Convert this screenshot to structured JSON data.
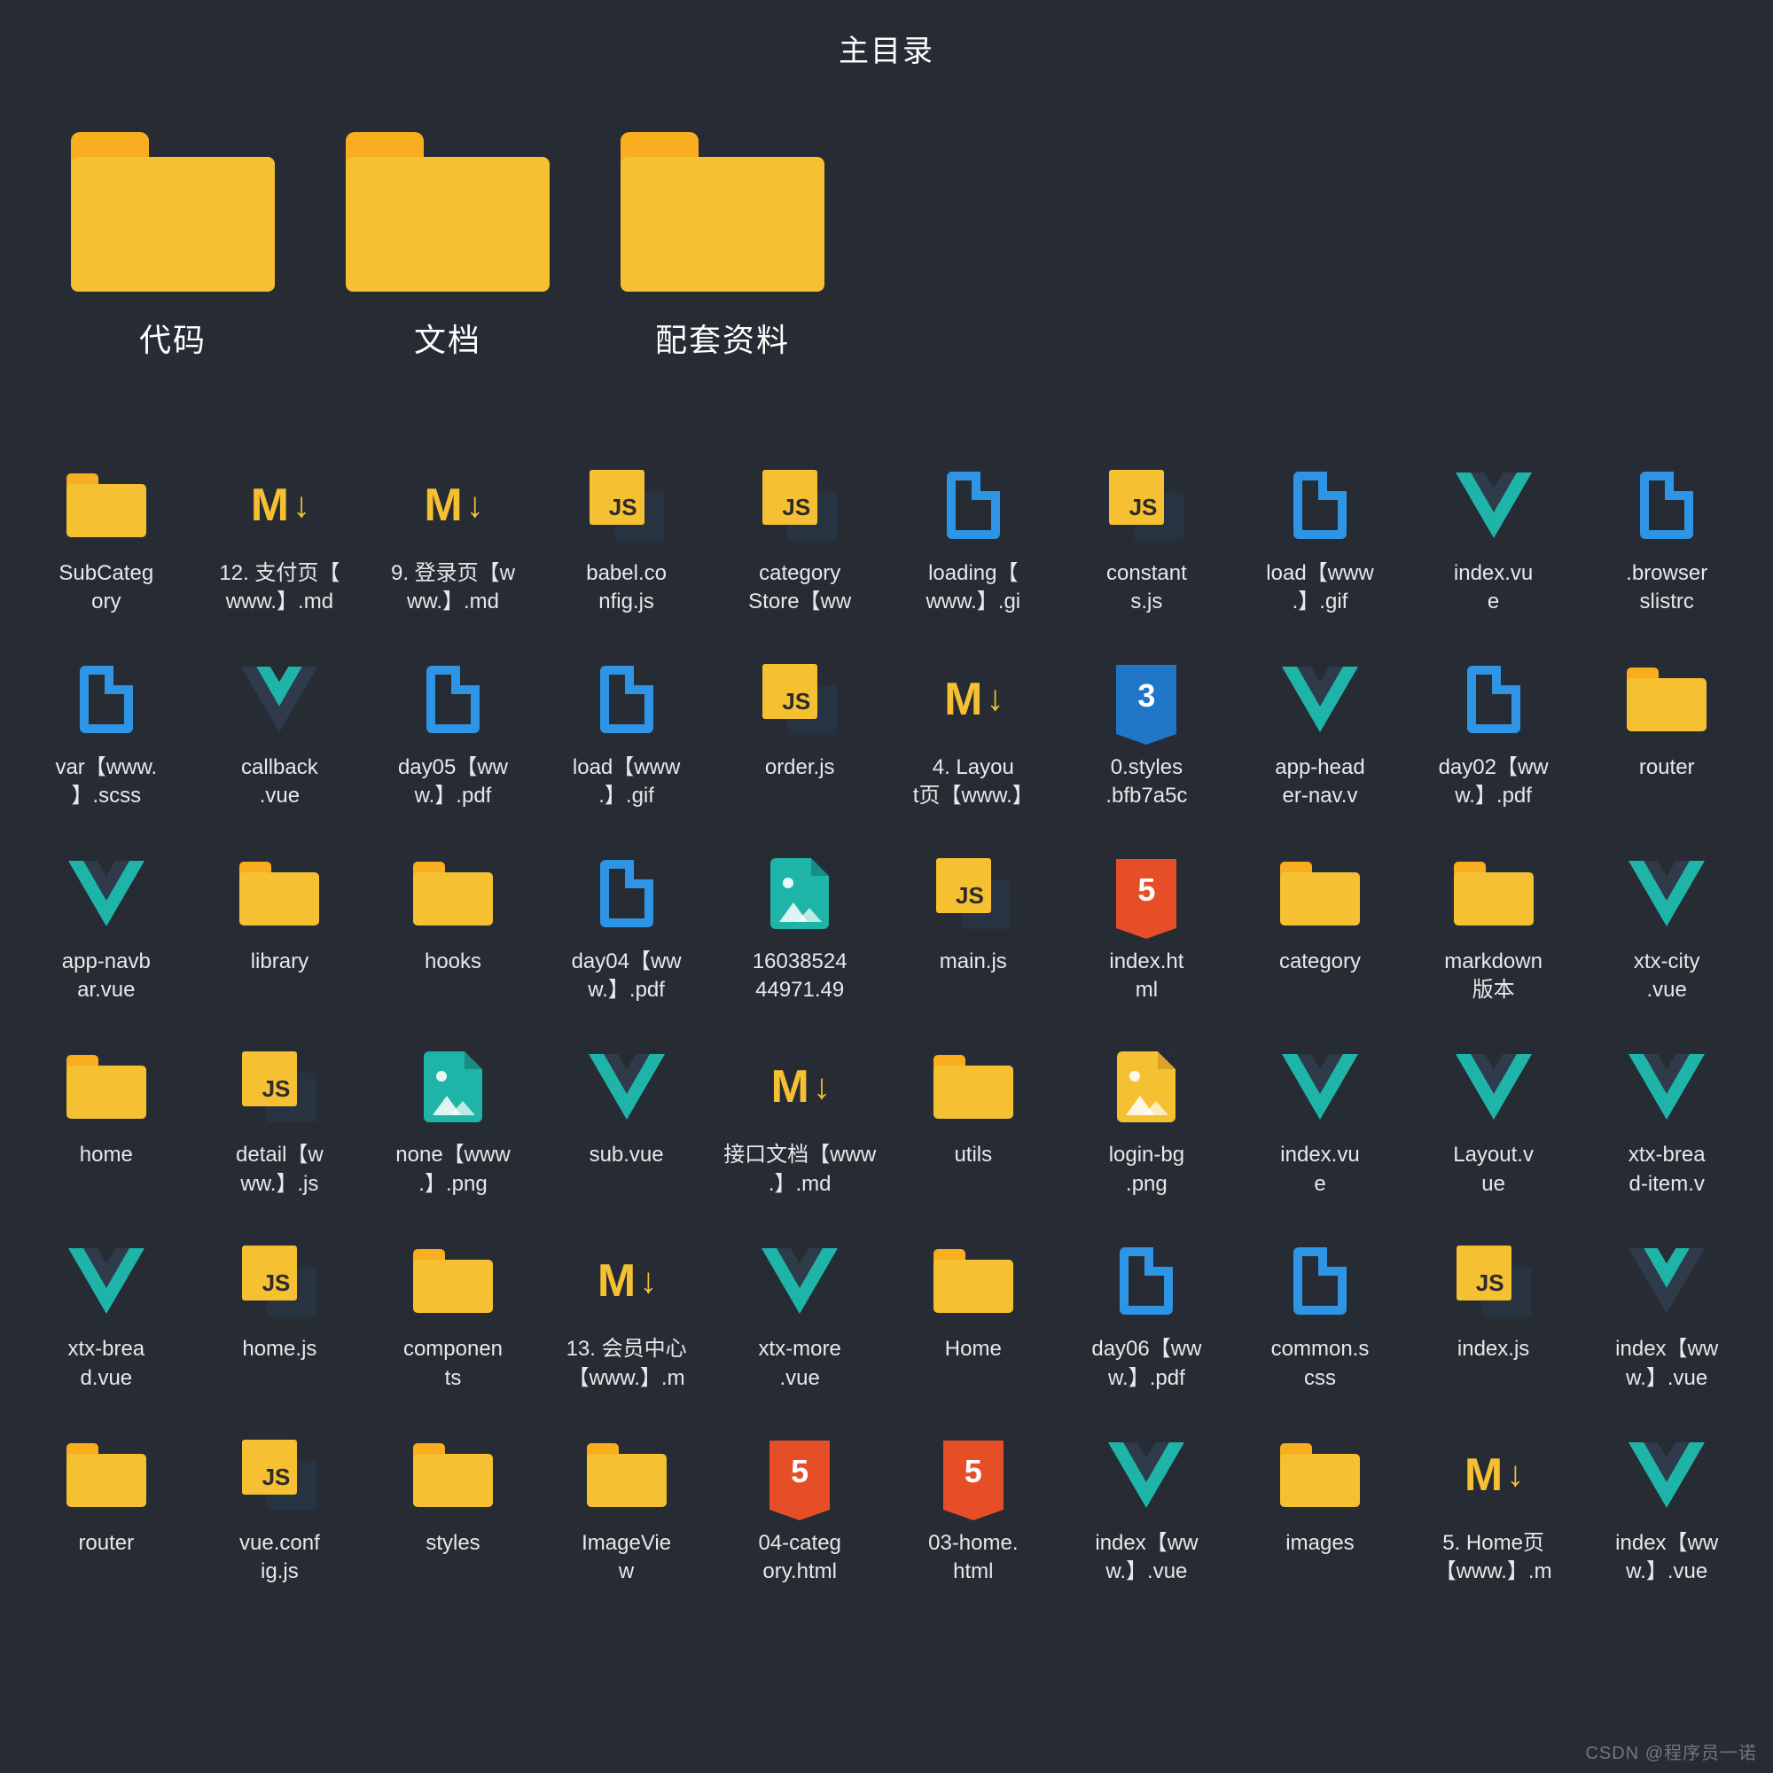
{
  "title": "主目录",
  "watermark": "CSDN @程序员一诺",
  "topFolders": [
    {
      "label": "代码"
    },
    {
      "label": "文档"
    },
    {
      "label": "配套资料"
    }
  ],
  "items": [
    {
      "icon": "folder",
      "label": "SubCateg\nory"
    },
    {
      "icon": "md",
      "label": "12. 支付页【\nwww.】.md"
    },
    {
      "icon": "md",
      "label": "9. 登录页【w\nww.】.md"
    },
    {
      "icon": "js",
      "label": "babel.co\nnfig.js"
    },
    {
      "icon": "js",
      "label": "category\nStore【ww"
    },
    {
      "icon": "file-blue",
      "label": "loading【\nwww.】.gi"
    },
    {
      "icon": "js",
      "label": "constant\ns.js"
    },
    {
      "icon": "file-blue",
      "label": "load【www\n.】.gif"
    },
    {
      "icon": "vue",
      "label": "index.vu\ne"
    },
    {
      "icon": "file-blue",
      "label": ".browser\nslistrc"
    },
    {
      "icon": "file-blue",
      "label": "var【www.\n】.scss"
    },
    {
      "icon": "vue-dark",
      "label": "callback\n.vue"
    },
    {
      "icon": "file-blue",
      "label": "day05【ww\nw.】.pdf"
    },
    {
      "icon": "file-blue",
      "label": "load【www\n.】.gif"
    },
    {
      "icon": "js",
      "label": "order.js"
    },
    {
      "icon": "md",
      "label": "4. Layou\nt页【www.】"
    },
    {
      "icon": "css3",
      "label": "0.styles\n.bfb7a5c"
    },
    {
      "icon": "vue",
      "label": "app-head\ner-nav.v"
    },
    {
      "icon": "file-blue",
      "label": "day02【ww\nw.】.pdf"
    },
    {
      "icon": "folder",
      "label": "router"
    },
    {
      "icon": "vue",
      "label": "app-navb\nar.vue"
    },
    {
      "icon": "folder",
      "label": "library"
    },
    {
      "icon": "folder",
      "label": "hooks"
    },
    {
      "icon": "file-blue",
      "label": "day04【ww\nw.】.pdf"
    },
    {
      "icon": "img-teal",
      "label": "16038524\n44971.49"
    },
    {
      "icon": "js",
      "label": "main.js"
    },
    {
      "icon": "html5",
      "label": "index.ht\nml"
    },
    {
      "icon": "folder",
      "label": "category"
    },
    {
      "icon": "folder",
      "label": "markdown\n版本"
    },
    {
      "icon": "vue",
      "label": "xtx-city\n.vue"
    },
    {
      "icon": "folder",
      "label": "home"
    },
    {
      "icon": "js",
      "label": "detail【w\nww.】.js"
    },
    {
      "icon": "img-teal",
      "label": "none【www\n.】.png"
    },
    {
      "icon": "vue",
      "label": "sub.vue"
    },
    {
      "icon": "md",
      "label": "接口文档【www\n.】.md"
    },
    {
      "icon": "folder",
      "label": "utils"
    },
    {
      "icon": "img-yellow",
      "label": "login-bg\n.png"
    },
    {
      "icon": "vue",
      "label": "index.vu\ne"
    },
    {
      "icon": "vue",
      "label": "Layout.v\nue"
    },
    {
      "icon": "vue",
      "label": "xtx-brea\nd-item.v"
    },
    {
      "icon": "vue",
      "label": "xtx-brea\nd.vue"
    },
    {
      "icon": "js",
      "label": "home.js"
    },
    {
      "icon": "folder",
      "label": "componen\nts"
    },
    {
      "icon": "md",
      "label": "13. 会员中心\n【www.】.m"
    },
    {
      "icon": "vue",
      "label": "xtx-more\n.vue"
    },
    {
      "icon": "folder",
      "label": "Home"
    },
    {
      "icon": "file-blue",
      "label": "day06【ww\nw.】.pdf"
    },
    {
      "icon": "file-blue",
      "label": "common.s\ncss"
    },
    {
      "icon": "js",
      "label": "index.js"
    },
    {
      "icon": "vue-dark",
      "label": "index【ww\nw.】.vue"
    },
    {
      "icon": "folder",
      "label": "router"
    },
    {
      "icon": "js",
      "label": "vue.conf\nig.js"
    },
    {
      "icon": "folder",
      "label": "styles"
    },
    {
      "icon": "folder",
      "label": "ImageVie\nw"
    },
    {
      "icon": "html5",
      "label": "04-categ\nory.html"
    },
    {
      "icon": "html5",
      "label": "03-home.\nhtml"
    },
    {
      "icon": "vue",
      "label": "index【ww\nw.】.vue"
    },
    {
      "icon": "folder",
      "label": "images"
    },
    {
      "icon": "md",
      "label": "5. Home页\n【www.】.m"
    },
    {
      "icon": "vue",
      "label": "index【ww\nw.】.vue"
    }
  ]
}
